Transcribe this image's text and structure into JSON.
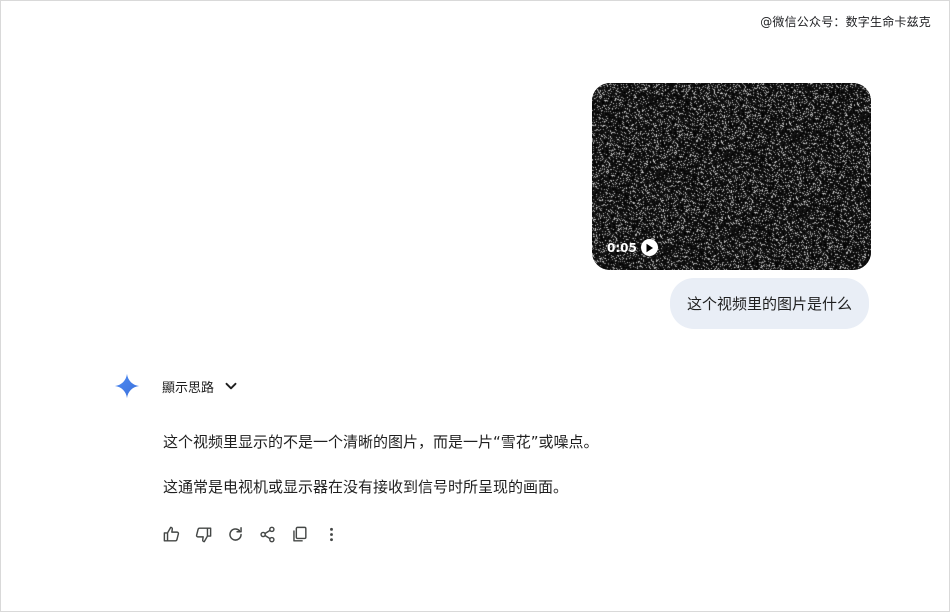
{
  "watermark": "@微信公众号：数字生命卡兹克",
  "user_message": {
    "video": {
      "duration": "0:05",
      "thumbnail_icon": "static-noise"
    },
    "text": "这个视频里的图片是什么"
  },
  "assistant": {
    "avatar_icon": "gemini-sparkle-icon",
    "show_thoughts_label": "顯示思路",
    "paragraphs": [
      "这个视频里显示的不是一个清晰的图片，而是一片“雪花”或噪点。",
      "这通常是电视机或显示器在没有接收到信号时所呈现的画面。"
    ],
    "actions": [
      {
        "icon": "thumbs-up-icon"
      },
      {
        "icon": "thumbs-down-icon"
      },
      {
        "icon": "regenerate-icon"
      },
      {
        "icon": "share-icon"
      },
      {
        "icon": "copy-icon"
      },
      {
        "icon": "more-vert-icon"
      }
    ]
  },
  "colors": {
    "user_bubble": "#e9eef6",
    "gemini_blue": "#4285f4",
    "icon_gray": "#444746"
  }
}
